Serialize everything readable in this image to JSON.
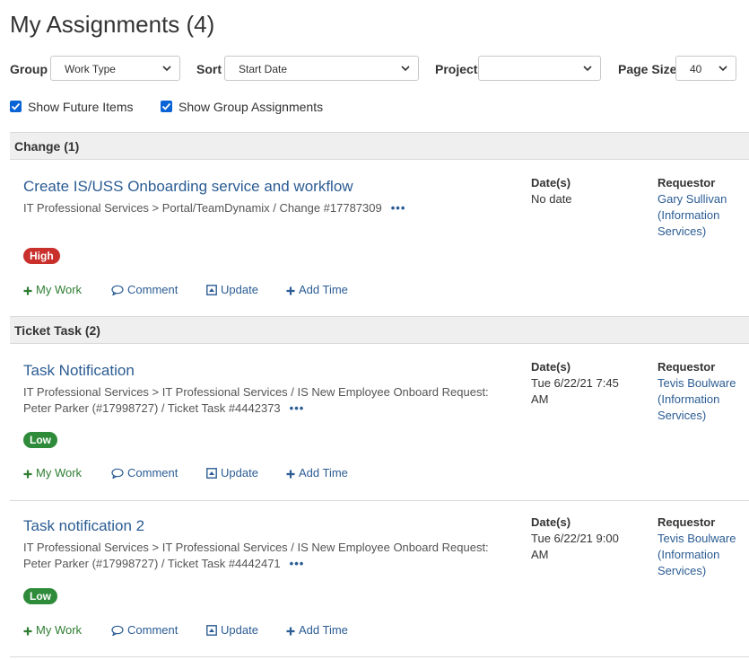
{
  "page": {
    "title": "My Assignments (4)"
  },
  "filters": {
    "group_label": "Group",
    "group_value": "Work Type",
    "sort_label": "Sort",
    "sort_value": "Start Date",
    "project_label": "Project",
    "project_value": "",
    "pagesize_label": "Page Size",
    "pagesize_value": "40"
  },
  "checkboxes": {
    "future_label": "Show Future Items",
    "future_checked": true,
    "group_label": "Show Group Assignments",
    "group_checked": true
  },
  "actions": {
    "mywork": "My Work",
    "comment": "Comment",
    "update": "Update",
    "addtime": "Add Time"
  },
  "labels": {
    "dates": "Date(s)",
    "requestor": "Requestor",
    "more": "•••"
  },
  "colors": {
    "link": "#2b5c93",
    "high": "#c9302c",
    "low": "#2e8b3a",
    "mywork": "#2e7d32"
  },
  "groups": [
    {
      "title": "Change (1)",
      "items": [
        {
          "title": "Create IS/USS Onboarding service and workflow",
          "path": "IT Professional Services > Portal/TeamDynamix / Change #17787309",
          "priority": "High",
          "date": "No date",
          "requestor": "Gary Sullivan (Information Services)"
        }
      ]
    },
    {
      "title": "Ticket Task (2)",
      "items": [
        {
          "title": "Task Notification",
          "path": "IT Professional Services > IT Professional Services / IS New Employee Onboard Request: Peter Parker (#17998727) / Ticket Task #4442373",
          "priority": "Low",
          "date": "Tue 6/22/21 7:45 AM",
          "requestor": "Tevis Boulware (Information Services)"
        },
        {
          "title": "Task notification 2",
          "path": "IT Professional Services > IT Professional Services / IS New Employee Onboard Request: Peter Parker (#17998727) / Ticket Task #4442471",
          "priority": "Low",
          "date": "Tue 6/22/21 9:00 AM",
          "requestor": "Tevis Boulware (Information Services)"
        }
      ]
    }
  ]
}
